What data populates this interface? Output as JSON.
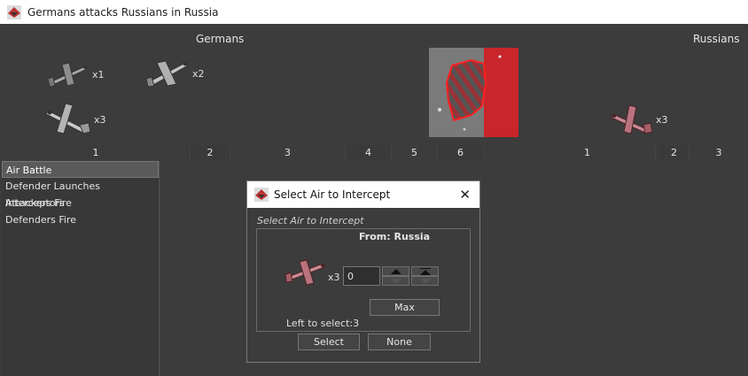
{
  "window": {
    "title": "Germans attacks Russians in Russia"
  },
  "sides": {
    "attacker": "Germans",
    "defender": "Russians"
  },
  "attacker_units": [
    {
      "count": "x1"
    },
    {
      "count": "x2"
    },
    {
      "count": "x3"
    }
  ],
  "defender_units": [
    {
      "count": "x3"
    }
  ],
  "dice": {
    "attacker": [
      "1",
      "2",
      "3",
      "4",
      "5",
      "6"
    ],
    "defender": [
      "1",
      "2",
      "3"
    ]
  },
  "steps": [
    {
      "label": "Air Battle"
    },
    {
      "label": "Defender Launches Interceptors"
    },
    {
      "label": "Attackers Fire"
    },
    {
      "label": "Defenders Fire"
    }
  ],
  "dialog": {
    "title": "Select Air to Intercept",
    "caption": "Select Air to Intercept",
    "from": "From: Russia",
    "unit_count": "x3",
    "quantity": "0",
    "max_label": "Max",
    "left_to_select": "Left to select:3",
    "select_label": "Select",
    "none_label": "None",
    "close_glyph": "✕"
  },
  "colors": {
    "german_plane": "#b8b8b8",
    "russian_plane": "#c98a92",
    "territory_red": "#c8262a"
  }
}
